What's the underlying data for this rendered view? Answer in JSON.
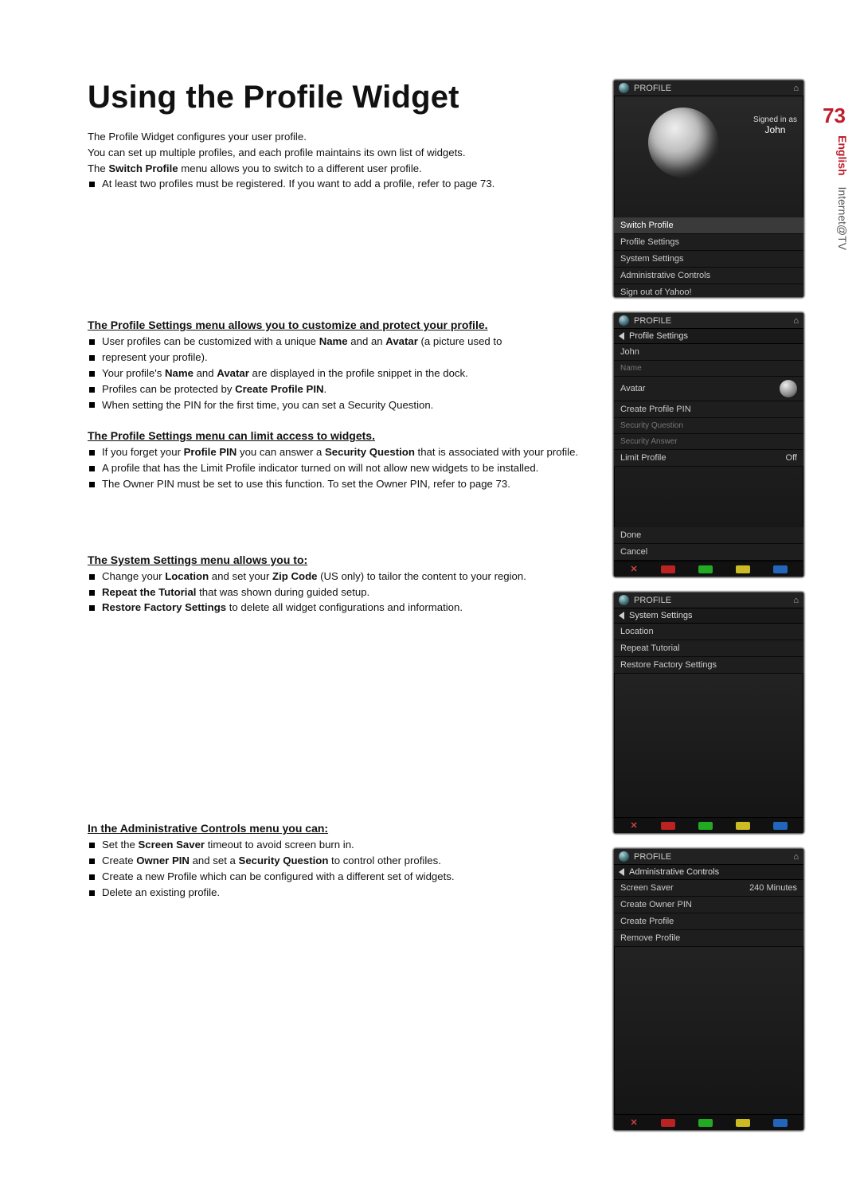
{
  "page_number": "73",
  "vtab": {
    "english": "English",
    "section": "Internet@TV"
  },
  "title": "Using the Profile Widget",
  "intro": {
    "l1": "The Profile Widget configures your user profile.",
    "l2": "You can set up multiple profiles, and each profile maintains its own list of widgets.",
    "l3_pre": "The ",
    "l3_bold": "Switch Profile",
    "l3_post": " menu allows you to switch to a different user profile.",
    "bullets": [
      "At least two profiles must be registered. If you want to add a profile, refer to page 73."
    ]
  },
  "profile_settings": {
    "heading": "The Profile Settings menu allows you to customize and protect your profile.",
    "bullets": [
      {
        "pre": "User profiles can be customized with a unique ",
        "b1": "Name",
        "mid": " and an ",
        "b2": "Avatar",
        "post": " (a picture used to"
      },
      {
        "pre": "represent your profile)."
      },
      {
        "pre": "Your profile's ",
        "b1": "Name",
        "mid": " and ",
        "b2": "Avatar",
        "post": " are displayed in the profile snippet in the dock."
      },
      {
        "pre": "Profiles can be protected by ",
        "b1": "Create Profile PIN",
        "post": "."
      },
      {
        "pre": "When setting the PIN for the first time, you can set a Security Question."
      }
    ]
  },
  "access": {
    "heading": "The Profile Settings menu can limit access to widgets.",
    "bullets": [
      {
        "pre": "If you forget your ",
        "b1": "Profile PIN",
        "mid": " you can answer a ",
        "b2": "Security Question",
        "post": " that is associated with your profile."
      },
      {
        "pre": "A profile that has the Limit Profile indicator turned on will not allow new widgets to be installed."
      },
      {
        "pre": "The Owner PIN must be set to use this function. To set the Owner PIN, refer to page 73."
      }
    ]
  },
  "system": {
    "heading": "The System Settings menu allows you to:",
    "bullets": [
      {
        "pre": "Change your ",
        "b1": "Location",
        "mid": " and set your ",
        "b2": "Zip Code",
        "post": " (US only) to tailor the content to your region."
      },
      {
        "b1": "Repeat the Tutorial",
        "post": " that was shown during guided setup."
      },
      {
        "b1": "Restore Factory Settings",
        "post": " to delete all widget configurations and information."
      }
    ]
  },
  "admin": {
    "heading": "In the Administrative Controls menu you can:",
    "bullets": [
      {
        "pre": "Set the ",
        "b1": "Screen Saver",
        "post": " timeout to avoid screen burn in."
      },
      {
        "pre": "Create ",
        "b1": "Owner PIN",
        "mid": " and set a ",
        "b2": "Security Question",
        "post": " to control other profiles."
      },
      {
        "pre": "Create a new Profile which can be configured with a different set of widgets."
      },
      {
        "pre": "Delete an existing profile."
      }
    ]
  },
  "widgets": {
    "header_label": "PROFILE",
    "main": {
      "signed_in_as": "Signed in as",
      "user": "John",
      "items": [
        "Switch Profile",
        "Profile Settings",
        "System Settings",
        "Administrative Controls",
        "Sign out of Yahoo!"
      ]
    },
    "profile_settings": {
      "sub": "Profile Settings",
      "items": [
        {
          "l": "John",
          "dim": false
        },
        {
          "l": "Name",
          "dim": true
        },
        {
          "l": "Avatar",
          "r": "avatar"
        },
        {
          "l": "Create Profile PIN"
        },
        {
          "l": "Security Question",
          "dim": true
        },
        {
          "l": "Security Answer",
          "dim": true
        },
        {
          "l": "Limit Profile",
          "r": "Off"
        }
      ],
      "footer_items": [
        "Done",
        "Cancel"
      ]
    },
    "system_settings": {
      "sub": "System Settings",
      "items": [
        "Location",
        "Repeat Tutorial",
        "Restore Factory Settings"
      ]
    },
    "admin_controls": {
      "sub": "Administrative Controls",
      "items": [
        {
          "l": "Screen Saver",
          "r": "240 Minutes"
        },
        {
          "l": "Create Owner PIN"
        },
        {
          "l": "Create Profile"
        },
        {
          "l": "Remove Profile"
        }
      ]
    }
  }
}
